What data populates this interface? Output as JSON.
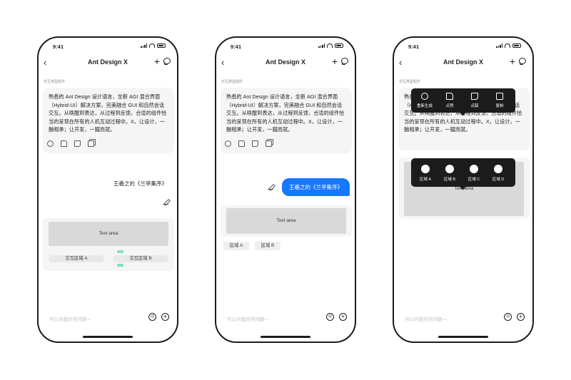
{
  "status_time": "9:41",
  "nav_title": "Ant Design X",
  "hint": "交互类型组件",
  "message_text": "熟悉的 Ant Design 设计语言，全新 AGI 混合界面（Hybrid-UI）解决方案，完美融合 GUI 和自然会话交互。从唤醒到表达，从过程到反馈，合适的组件恰当的呈现在所有的人机互动过程中。X，让设计，一触相承；让开发，一蹴而就。",
  "user_message": "王羲之的《兰亭集序》",
  "text_area_label": "Text area",
  "phone1": {
    "region_a": "交互区域 A",
    "region_b": "交互区域 B"
  },
  "phone2": {
    "region_a": "区域 A",
    "region_b": "区域 B"
  },
  "phone3": {
    "menu": [
      {
        "label": "重新生成",
        "icon": "refresh-icon"
      },
      {
        "label": "点赞",
        "icon": "thumbs-up-icon"
      },
      {
        "label": "点踩",
        "icon": "thumbs-down-icon"
      },
      {
        "label": "复制",
        "icon": "copy-icon"
      }
    ],
    "regions": [
      "区域 A",
      "区域 B",
      "区域 C",
      "区域 D"
    ]
  },
  "input_placeholder": "可以问我任何问题～",
  "accent_color": "#1677ff"
}
